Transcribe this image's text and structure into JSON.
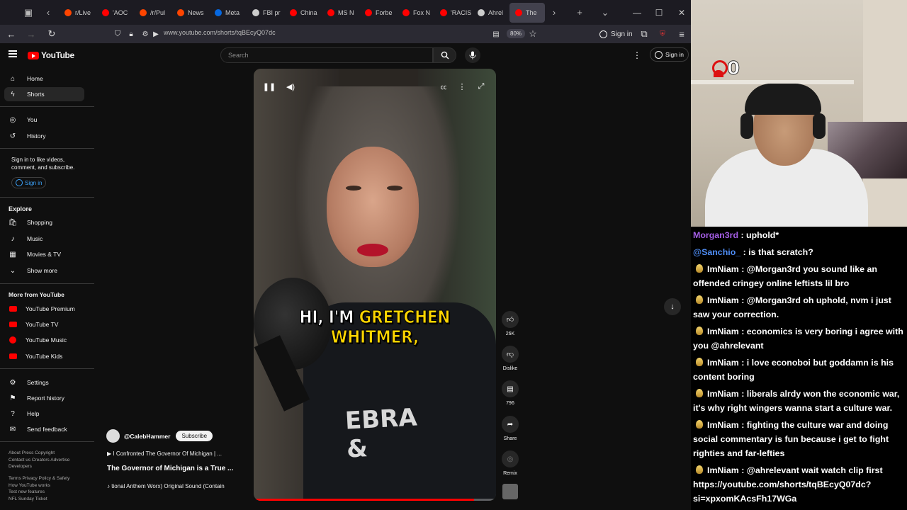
{
  "browser": {
    "tabs": [
      {
        "label": "r/Live",
        "color": "#ff4500"
      },
      {
        "label": "'AOC",
        "color": "#ff0000"
      },
      {
        "label": "/r/Pul",
        "color": "#ff4500"
      },
      {
        "label": "News",
        "color": "#ff4500"
      },
      {
        "label": "Meta",
        "color": "#0668e1"
      },
      {
        "label": "FBI pr",
        "color": "#cccccc"
      },
      {
        "label": "China",
        "color": "#ff0000"
      },
      {
        "label": "MS N",
        "color": "#ff0000"
      },
      {
        "label": "Forbe",
        "color": "#ff0000"
      },
      {
        "label": "Fox N",
        "color": "#ff0000"
      },
      {
        "label": "'RACIS",
        "color": "#ff0000"
      },
      {
        "label": "Ahrel",
        "color": "#cccccc"
      },
      {
        "label": "The",
        "color": "#ff0000"
      }
    ],
    "url": "www.youtube.com/shorts/tqBEcyQ07dc",
    "zoom": "80%",
    "sign_in": "Sign in",
    "ext_badge": "18"
  },
  "youtube": {
    "logo": "YouTube",
    "search_placeholder": "Search",
    "signin": "Sign in"
  },
  "sidebar": {
    "main": [
      {
        "label": "Home",
        "icon": "home-icon"
      },
      {
        "label": "Shorts",
        "icon": "shorts-icon"
      }
    ],
    "you": [
      {
        "label": "You",
        "icon": "you-icon"
      },
      {
        "label": "History",
        "icon": "history-icon"
      }
    ],
    "signin_prompt": "Sign in to like videos, comment, and subscribe.",
    "signin_button": "Sign in",
    "explore_title": "Explore",
    "explore": [
      {
        "label": "Shopping",
        "icon": "shopping-icon"
      },
      {
        "label": "Music",
        "icon": "music-icon"
      },
      {
        "label": "Movies & TV",
        "icon": "movies-icon"
      },
      {
        "label": "Show more",
        "icon": "chevron-down-icon"
      }
    ],
    "more_title": "More from YouTube",
    "more": [
      {
        "label": "YouTube Premium"
      },
      {
        "label": "YouTube TV"
      },
      {
        "label": "YouTube Music"
      },
      {
        "label": "YouTube Kids"
      }
    ],
    "settings": [
      {
        "label": "Settings",
        "icon": "gear-icon"
      },
      {
        "label": "Report history",
        "icon": "flag-icon"
      },
      {
        "label": "Help",
        "icon": "help-icon"
      },
      {
        "label": "Send feedback",
        "icon": "feedback-icon"
      }
    ],
    "footer": [
      "About  Press  Copyright",
      "Contact us  Creators  Advertise",
      "Developers",
      "Terms  Privacy  Policy & Safety",
      "How YouTube works",
      "Test new features",
      "NFL Sunday Ticket"
    ]
  },
  "video": {
    "caption_white": "HI, I'M ",
    "caption_yellow": "GRETCHEN",
    "caption_line2": "WHITMER,",
    "shirt_text": "EBRA\n&",
    "progress": 0.91,
    "channel": "@CalebHammer",
    "subscribe": "Subscribe",
    "related": "I Confronted The Governor Of Michigan | ...",
    "title": "The Governor of Michigan is a True ...",
    "sound": "tional Anthem Worx)   Original Sound (Contain",
    "likes": "26K",
    "dislike": "Dislike",
    "comments": "796",
    "share": "Share",
    "remix": "Remix"
  },
  "stream": {
    "viewer_count": "0",
    "chat": [
      {
        "user": "Morgan3rd",
        "user_color": "#a45ee5",
        "badge": false,
        "text": " : uphold*"
      },
      {
        "user": "@Sanchio_",
        "user_color": "#4f8ef7",
        "badge": false,
        "text": " : is that scratch?"
      },
      {
        "user": "ImNiam",
        "user_color": "#ffffff",
        "badge": true,
        "text": " : @Morgan3rd you sound like an offended cringey online leftists lil bro"
      },
      {
        "user": "ImNiam",
        "user_color": "#ffffff",
        "badge": true,
        "text": " : @Morgan3rd oh uphold, nvm i just saw your correction."
      },
      {
        "user": "ImNiam",
        "user_color": "#ffffff",
        "badge": true,
        "text": " : economics is very boring i agree with you @ahrelevant"
      },
      {
        "user": "ImNiam",
        "user_color": "#ffffff",
        "badge": true,
        "text": " : i love econoboi but goddamn is his content boring"
      },
      {
        "user": "ImNiam",
        "user_color": "#ffffff",
        "badge": true,
        "text": " : liberals alrdy won the economic war, it's why right wingers wanna start a culture war."
      },
      {
        "user": "ImNiam",
        "user_color": "#ffffff",
        "badge": true,
        "text": " : fighting the culture war and doing social commentary is fun because i get to fight righties and far-lefties"
      },
      {
        "user": "ImNiam",
        "user_color": "#ffffff",
        "badge": true,
        "text": " : @ahrelevant wait watch clip first https://youtube.com/shorts/tqBEcyQ07dc?si=xpxomKAcsFh17WGa"
      }
    ]
  }
}
